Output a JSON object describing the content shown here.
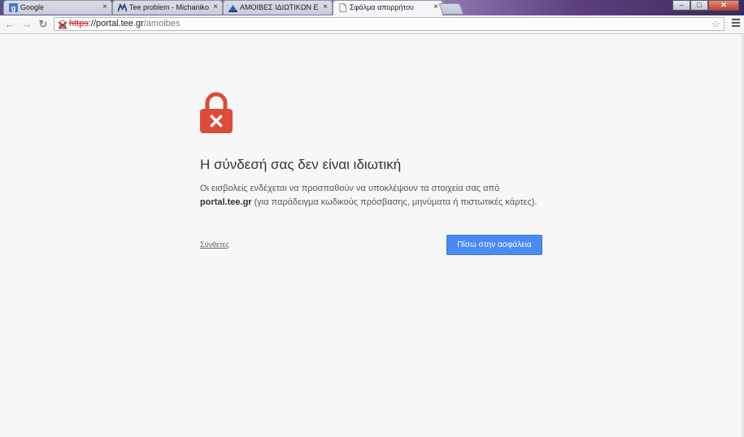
{
  "tabs": [
    {
      "title": "Google",
      "icon": "google-favicon",
      "active": false
    },
    {
      "title": "Tee problem - Michanikoi",
      "icon": "michanikoi-favicon",
      "active": false
    },
    {
      "title": "ΑΜΟΙΒΕΣ ΙΔΙΩΤΙΚΩΝ ΕΡΓΩ",
      "icon": "tee-favicon",
      "active": false
    },
    {
      "title": "Σφάλμα απορρήτου",
      "icon": "page-icon",
      "active": true
    }
  ],
  "tab_close_glyph": "×",
  "address_bar": {
    "scheme": "https",
    "separator": "://",
    "host": "portal.tee.gr",
    "path": "/amoibes"
  },
  "window_controls": {
    "minimize": "–",
    "maximize": "□",
    "close": "✕"
  },
  "page": {
    "heading": "Η σύνδεσή σας δεν είναι ιδιωτική",
    "body_line1": "Οι εισβολείς ενδέχεται να προσπαθούν να υποκλέψουν τα στοιχεία σας από",
    "body_host": "portal.tee.gr",
    "body_line2_rest": " (για παράδειγμα κωδικούς πρόσβασης, μηνύματα ή πιστωτικές κάρτες).",
    "details_link": "Σύνθετες",
    "primary_button": "Πίσω στην ασφάλεια"
  },
  "colors": {
    "lock_red": "#dd4b39",
    "button_blue": "#4a8af4",
    "insecure_scheme": "#c8201f"
  }
}
